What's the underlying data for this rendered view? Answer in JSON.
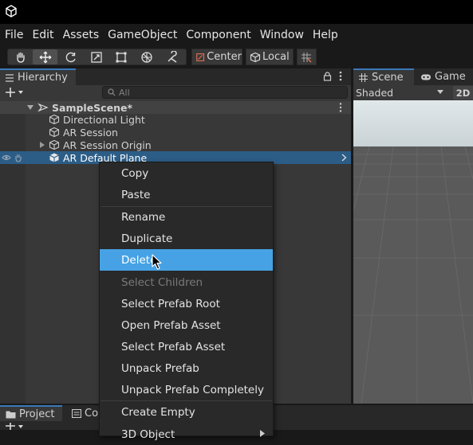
{
  "menubar": [
    "File",
    "Edit",
    "Assets",
    "GameObject",
    "Component",
    "Window",
    "Help"
  ],
  "toolbar": {
    "pivot_label": "Center",
    "space_label": "Local"
  },
  "hierarchy": {
    "tab_label": "Hierarchy",
    "search_placeholder": "All",
    "scene_name": "SampleScene*",
    "items": [
      "Directional Light",
      "AR Session",
      "AR Session Origin",
      "AR Default Plane"
    ]
  },
  "scene_panel": {
    "scene_tab": "Scene",
    "game_tab": "Game",
    "shading_mode": "Shaded",
    "mode_2d": "2D"
  },
  "bottom": {
    "project_tab": "Project",
    "console_tab": "Co"
  },
  "context_menu": {
    "items": [
      "Copy",
      "Paste",
      "Rename",
      "Duplicate",
      "Delete",
      "Select Children",
      "Select Prefab Root",
      "Open Prefab Asset",
      "Select Prefab Asset",
      "Unpack Prefab",
      "Unpack Prefab Completely",
      "Create Empty",
      "3D Object"
    ]
  },
  "colors": {
    "accent": "#3a79bb",
    "highlight": "#46a2e4",
    "selection": "#2c5d87"
  }
}
